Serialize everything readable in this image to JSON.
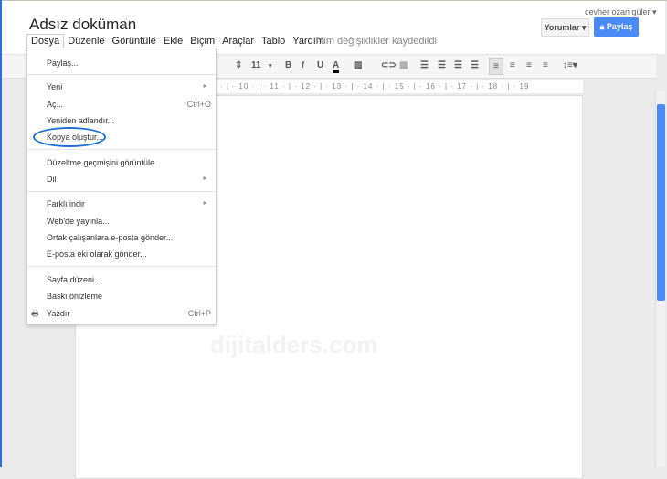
{
  "header": {
    "title": "Adsız doküman",
    "user": "cevher ozan güler ▾",
    "comments_button": "Yorumlar ▾",
    "share_button": "Paylaş",
    "saved_status": "Tüm değişiklikler kaydedildi"
  },
  "menubar": [
    "Dosya",
    "Düzenle",
    "Görüntüle",
    "Ekle",
    "Biçim",
    "Araçlar",
    "Tablo",
    "Yardım"
  ],
  "toolbar": {
    "font_size": "11",
    "bold": "B",
    "italic": "I",
    "underline": "U",
    "text_color": "A"
  },
  "ruler": "· 4 · | · 5 · | · 6 · | · 7 · | · 8 · | · 9 · | · 10 · | · 11 · | · 12 · | · 13 · | · 14 · | · 15 · | · 16 · | · 17 · | · 18 · | · 19",
  "file_menu": {
    "items": [
      {
        "label": "Paylaş..."
      },
      {
        "label": "Yeni",
        "submenu": true
      },
      {
        "label": "Aç...",
        "shortcut": "Ctrl+O"
      },
      {
        "label": "Yeniden adlandır..."
      },
      {
        "label": "Kopya oluştur...",
        "highlighted": true
      },
      {
        "label": "Düzeltme geçmişini görüntüle"
      },
      {
        "label": "Dil",
        "submenu": true
      },
      {
        "label": "Farklı indir",
        "submenu": true
      },
      {
        "label": "Web'de yayınla..."
      },
      {
        "label": "Ortak çalışanlara e-posta gönder..."
      },
      {
        "label": "E-posta eki olarak gönder..."
      },
      {
        "label": "Sayfa düzeni..."
      },
      {
        "label": "Baskı önizleme"
      },
      {
        "label": "Yazdır",
        "shortcut": "Ctrl+P",
        "icon": "printer-icon"
      }
    ]
  },
  "watermark": "dijitalders.com",
  "colors": {
    "accent": "#4a8af4",
    "highlight_ellipse": "#1e6fd9"
  }
}
